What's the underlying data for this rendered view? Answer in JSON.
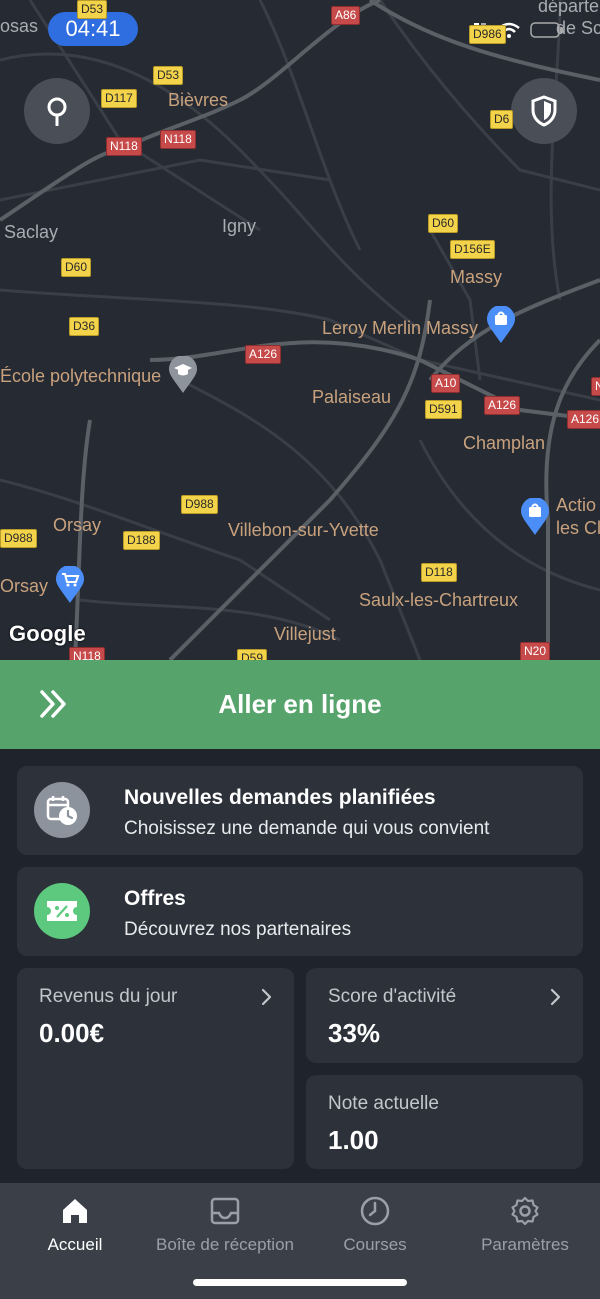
{
  "status_bar": {
    "time": "04:41"
  },
  "map": {
    "attribution": "Google",
    "places": [
      {
        "id": "bievres",
        "label": "Bièvres"
      },
      {
        "id": "saclay",
        "label": "Saclay"
      },
      {
        "id": "igny",
        "label": "Igny"
      },
      {
        "id": "massy",
        "label": "Massy"
      },
      {
        "id": "leroy",
        "label": "Leroy Merlin Massy"
      },
      {
        "id": "polytechnique",
        "label": "École polytechnique"
      },
      {
        "id": "palaiseau",
        "label": "Palaiseau"
      },
      {
        "id": "champlan",
        "label": "Champlan"
      },
      {
        "id": "orsay1",
        "label": "Orsay"
      },
      {
        "id": "villebon",
        "label": "Villebon-sur-Yvette"
      },
      {
        "id": "orsay2",
        "label": "Orsay"
      },
      {
        "id": "saulx",
        "label": "Saulx-les-Chartreux"
      },
      {
        "id": "villejust",
        "label": "Villejust"
      },
      {
        "id": "osas",
        "label": "osas"
      },
      {
        "id": "departe",
        "label": "départe"
      },
      {
        "id": "desc",
        "label": "de Sc"
      },
      {
        "id": "actio",
        "label": "Actio"
      },
      {
        "id": "lesc",
        "label": "les Cl"
      }
    ],
    "shields": [
      {
        "id": "a86",
        "label": "A86",
        "kind": "r"
      },
      {
        "id": "d53a",
        "label": "D53",
        "kind": "y"
      },
      {
        "id": "d53b",
        "label": "D53",
        "kind": "y"
      },
      {
        "id": "d117",
        "label": "D117",
        "kind": "y"
      },
      {
        "id": "n118a",
        "label": "N118",
        "kind": "r"
      },
      {
        "id": "n118b",
        "label": "N118",
        "kind": "r"
      },
      {
        "id": "d986",
        "label": "D986",
        "kind": "y"
      },
      {
        "id": "d6",
        "label": "D6",
        "kind": "y"
      },
      {
        "id": "d60a",
        "label": "D60",
        "kind": "y"
      },
      {
        "id": "d156e",
        "label": "D156E",
        "kind": "y"
      },
      {
        "id": "d60b",
        "label": "D60",
        "kind": "y"
      },
      {
        "id": "d36",
        "label": "D36",
        "kind": "y"
      },
      {
        "id": "a126a",
        "label": "A126",
        "kind": "r"
      },
      {
        "id": "a10",
        "label": "A10",
        "kind": "r"
      },
      {
        "id": "d591",
        "label": "D591",
        "kind": "y"
      },
      {
        "id": "a126b",
        "label": "A126",
        "kind": "r"
      },
      {
        "id": "a126c",
        "label": "A126",
        "kind": "r"
      },
      {
        "id": "n",
        "label": "N",
        "kind": "r"
      },
      {
        "id": "d988a",
        "label": "D988",
        "kind": "y"
      },
      {
        "id": "d988b",
        "label": "D988",
        "kind": "y"
      },
      {
        "id": "d188",
        "label": "D188",
        "kind": "y"
      },
      {
        "id": "d118",
        "label": "D118",
        "kind": "y"
      },
      {
        "id": "n118c",
        "label": "N118",
        "kind": "r"
      },
      {
        "id": "d59",
        "label": "D59",
        "kind": "y"
      },
      {
        "id": "n20",
        "label": "N20",
        "kind": "r"
      }
    ]
  },
  "online": {
    "label": "Aller en ligne"
  },
  "cards": {
    "scheduled": {
      "title": "Nouvelles demandes planifiées",
      "subtitle": "Choisissez une demande qui vous convient"
    },
    "offers": {
      "title": "Offres",
      "subtitle": "Découvrez nos partenaires"
    }
  },
  "stats": {
    "revenue": {
      "label": "Revenus du jour",
      "value": "0.00€"
    },
    "activity": {
      "label": "Score d'activité",
      "value": "33%"
    },
    "rating": {
      "label": "Note actuelle",
      "value": "1.00"
    }
  },
  "nav": {
    "items": [
      {
        "label": "Accueil",
        "icon": "home-icon",
        "active": true
      },
      {
        "label": "Boîte de réception",
        "icon": "inbox-icon",
        "active": false
      },
      {
        "label": "Courses",
        "icon": "clock-icon",
        "active": false
      },
      {
        "label": "Paramètres",
        "icon": "gear-icon",
        "active": false
      }
    ]
  },
  "colors": {
    "online_green": "#56a36b",
    "card_bg": "#2c313a",
    "status_time_bg": "#2f6ee0",
    "scheduled_icon_bg": "#8d939c",
    "offers_icon_bg": "#5cc97e"
  }
}
